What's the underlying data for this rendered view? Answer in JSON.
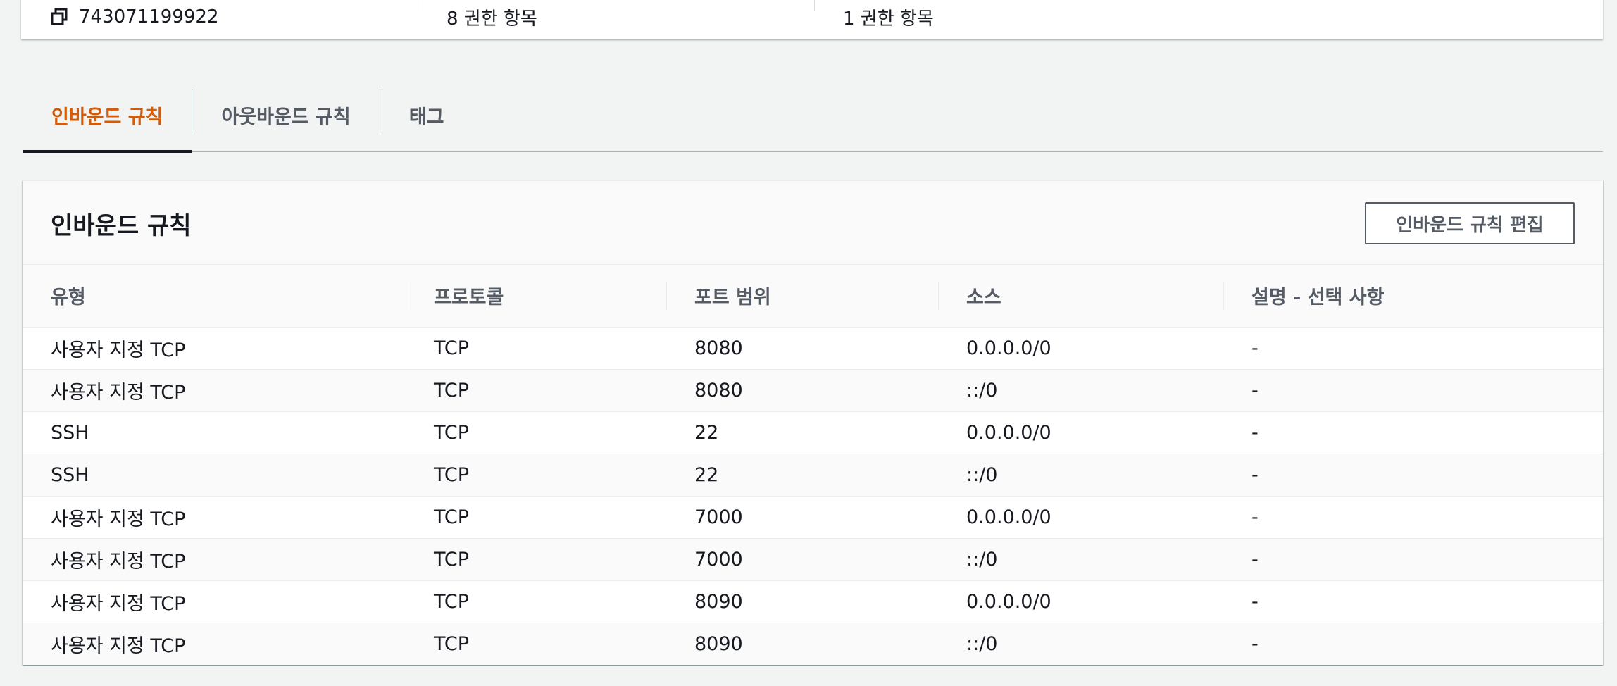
{
  "summary": {
    "owner_id": "743071199922",
    "inbound_count": "8 권한 항목",
    "outbound_count": "1 권한 항목"
  },
  "tabs": [
    {
      "label": "인바운드 규칙",
      "active": true
    },
    {
      "label": "아웃바운드 규칙",
      "active": false
    },
    {
      "label": "태그",
      "active": false
    }
  ],
  "panel": {
    "title": "인바운드 규칙",
    "edit_button": "인바운드 규칙 편집"
  },
  "table": {
    "headers": [
      "유형",
      "프로토콜",
      "포트 범위",
      "소스",
      "설명 - 선택 사항"
    ],
    "rows": [
      [
        "사용자 지정 TCP",
        "TCP",
        "8080",
        "0.0.0.0/0",
        "-"
      ],
      [
        "사용자 지정 TCP",
        "TCP",
        "8080",
        "::/0",
        "-"
      ],
      [
        "SSH",
        "TCP",
        "22",
        "0.0.0.0/0",
        "-"
      ],
      [
        "SSH",
        "TCP",
        "22",
        "::/0",
        "-"
      ],
      [
        "사용자 지정 TCP",
        "TCP",
        "7000",
        "0.0.0.0/0",
        "-"
      ],
      [
        "사용자 지정 TCP",
        "TCP",
        "7000",
        "::/0",
        "-"
      ],
      [
        "사용자 지정 TCP",
        "TCP",
        "8090",
        "0.0.0.0/0",
        "-"
      ],
      [
        "사용자 지정 TCP",
        "TCP",
        "8090",
        "::/0",
        "-"
      ]
    ]
  },
  "colors": {
    "active_tab": "#d45b07",
    "tab_underline": "#16191f",
    "page_bg": "#f2f3f3"
  }
}
